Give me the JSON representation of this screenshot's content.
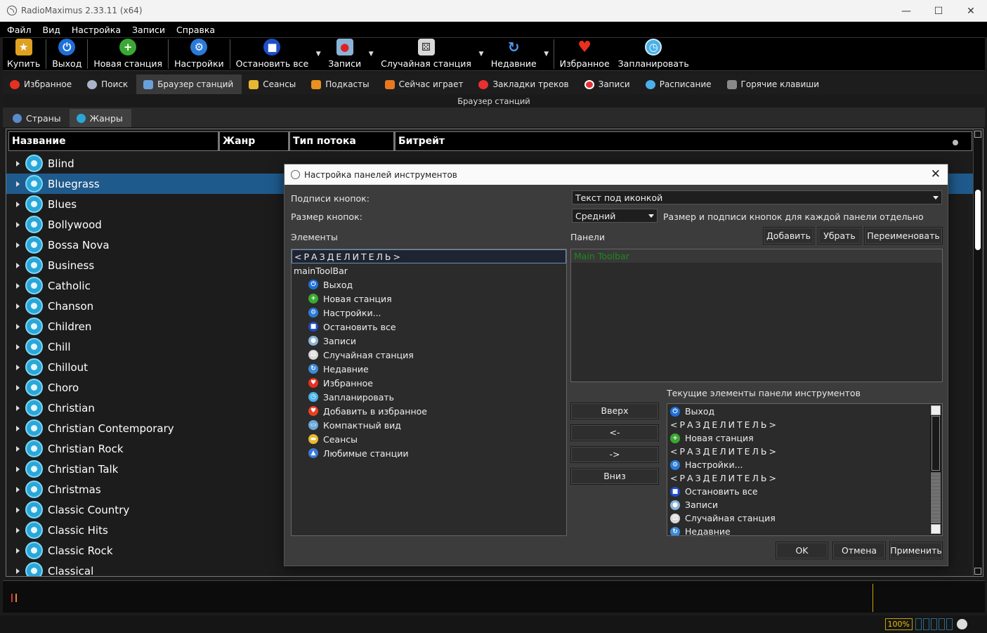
{
  "window": {
    "title": "RadioMaximus 2.33.11 (x64)",
    "controls": {
      "minimize": "—",
      "maximize": "☐",
      "close": "✕"
    }
  },
  "menu": [
    "Файл",
    "Вид",
    "Настройка",
    "Записи",
    "Справка"
  ],
  "toolbar": {
    "buttons": [
      {
        "label": "Купить",
        "icon": "buy-icon",
        "color": "#e0a020"
      },
      {
        "label": "Выход",
        "icon": "power-icon",
        "color": "#1e6fd8"
      },
      {
        "label": "Новая станция",
        "icon": "plus-icon",
        "color": "#3aa832"
      },
      {
        "label": "Настройки",
        "icon": "gear-icon",
        "color": "#2a7ad8"
      },
      {
        "label": "Остановить все",
        "icon": "stop-icon",
        "color": "#1e4ec8"
      },
      {
        "label": "Записи",
        "icon": "record-icon",
        "color": "#8ab4d8"
      },
      {
        "label": "Случайная станция",
        "icon": "dice-icon",
        "color": "#d8d8d8"
      },
      {
        "label": "Недавние",
        "icon": "refresh-icon",
        "color": "#2a7ad8"
      },
      {
        "label": "Избранное",
        "icon": "heart-icon",
        "color": "#e83020"
      },
      {
        "label": "Запланировать",
        "icon": "clock-icon",
        "color": "#4ab0e8"
      }
    ]
  },
  "tabs": [
    {
      "label": "Избранное",
      "icon": "heart-icon",
      "color": "#e83020"
    },
    {
      "label": "Поиск",
      "icon": "search-icon",
      "color": "#aab4c8"
    },
    {
      "label": "Браузер станций",
      "icon": "browser-icon",
      "color": "#6aa0d8"
    },
    {
      "label": "Сеансы",
      "icon": "folder-icon",
      "color": "#e8b830"
    },
    {
      "label": "Подкасты",
      "icon": "podcast-icon",
      "color": "#e89020"
    },
    {
      "label": "Сейчас играет",
      "icon": "now-playing-icon",
      "color": "#e87820"
    },
    {
      "label": "Закладки треков",
      "icon": "bookmark-icon",
      "color": "#e83030"
    },
    {
      "label": "Записи",
      "icon": "record-icon",
      "color": "#e83030"
    },
    {
      "label": "Расписание",
      "icon": "clock-icon",
      "color": "#4ab0e8"
    },
    {
      "label": "Горячие клавиши",
      "icon": "keyboard-icon",
      "color": "#aaaaaa"
    }
  ],
  "section_title": "Браузер станций",
  "subtabs": [
    {
      "label": "Страны",
      "icon": "globe-icon"
    },
    {
      "label": "Жанры",
      "icon": "globe-icon"
    }
  ],
  "table": {
    "columns": [
      "Название",
      "Жанр",
      "Тип потока",
      "Битрейт"
    ],
    "genres": [
      "Blind",
      "Bluegrass",
      "Blues",
      "Bollywood",
      "Bossa Nova",
      "Business",
      "Catholic",
      "Chanson",
      "Children",
      "Chill",
      "Chillout",
      "Choro",
      "Christian",
      "Christian Contemporary",
      "Christian Rock",
      "Christian Talk",
      "Christmas",
      "Classic Country",
      "Classic Hits",
      "Classic Rock",
      "Classical"
    ],
    "selected": "Bluegrass"
  },
  "dialog": {
    "title": "Настройка панелей инструментов",
    "captions_label": "Подписи кнопок:",
    "captions_value": "Текст под иконкой",
    "size_label": "Размер кнопок:",
    "size_value": "Средний",
    "per_panel_note": "Размер и подписи кнопок для каждой панели отдельно",
    "elements_label": "Элементы",
    "panels_label": "Панели",
    "add_button": "Добавить",
    "remove_button": "Убрать",
    "rename_button": "Переименовать",
    "separator": "<РАЗДЕЛИТЕЛЬ>",
    "group_name": "mainToolBar",
    "elements": [
      {
        "label": "Выход",
        "icon": "power-icon",
        "color": "#1e6fd8"
      },
      {
        "label": "Новая станция",
        "icon": "plus-icon",
        "color": "#3aa832"
      },
      {
        "label": "Настройки...",
        "icon": "gear-icon",
        "color": "#2a7ad8"
      },
      {
        "label": "Остановить все",
        "icon": "stop-icon",
        "color": "#1e4ec8"
      },
      {
        "label": "Записи",
        "icon": "record-icon",
        "color": "#8ab4d8"
      },
      {
        "label": "Случайная станция",
        "icon": "dice-icon",
        "color": "#d8d8d8"
      },
      {
        "label": "Недавние",
        "icon": "refresh-icon",
        "color": "#3a8ad8"
      },
      {
        "label": "Избранное",
        "icon": "heart-icon",
        "color": "#e83020"
      },
      {
        "label": "Запланировать",
        "icon": "clock-icon",
        "color": "#4ab0e8"
      },
      {
        "label": "Добавить в избранное",
        "icon": "heart-plus-icon",
        "color": "#e84020"
      },
      {
        "label": "Компактный вид",
        "icon": "compact-icon",
        "color": "#6aa8d8"
      },
      {
        "label": "Сеансы",
        "icon": "folder-icon",
        "color": "#e8b830"
      },
      {
        "label": "Любимые станции",
        "icon": "thumbs-up-icon",
        "color": "#3a7ad8"
      }
    ],
    "panels": [
      "Main Toolbar"
    ],
    "current_label": "Текущие элементы панели инструментов",
    "current_items": [
      {
        "label": "Выход",
        "icon": "power-icon",
        "color": "#1e6fd8",
        "sep": false
      },
      {
        "label": "<РАЗДЕЛИТЕЛЬ>",
        "icon": "",
        "color": "",
        "sep": true
      },
      {
        "label": "Новая станция",
        "icon": "plus-icon",
        "color": "#3aa832",
        "sep": false
      },
      {
        "label": "<РАЗДЕЛИТЕЛЬ>",
        "icon": "",
        "color": "",
        "sep": true
      },
      {
        "label": "Настройки...",
        "icon": "gear-icon",
        "color": "#2a7ad8",
        "sep": false
      },
      {
        "label": "<РАЗДЕЛИТЕЛЬ>",
        "icon": "",
        "color": "",
        "sep": true
      },
      {
        "label": "Остановить все",
        "icon": "stop-icon",
        "color": "#1e4ec8",
        "sep": false
      },
      {
        "label": "Записи",
        "icon": "record-icon",
        "color": "#8ab4d8",
        "sep": false
      },
      {
        "label": "Случайная станция",
        "icon": "dice-icon",
        "color": "#d8d8d8",
        "sep": false
      },
      {
        "label": "Недавние",
        "icon": "refresh-icon",
        "color": "#3a8ad8",
        "sep": false
      }
    ],
    "up_button": "Вверх",
    "left_button": "<-",
    "right_button": "->",
    "down_button": "Вниз",
    "ok_button": "OK",
    "cancel_button": "Отмена",
    "apply_button": "Применить"
  },
  "status": {
    "zoom": "100%"
  }
}
